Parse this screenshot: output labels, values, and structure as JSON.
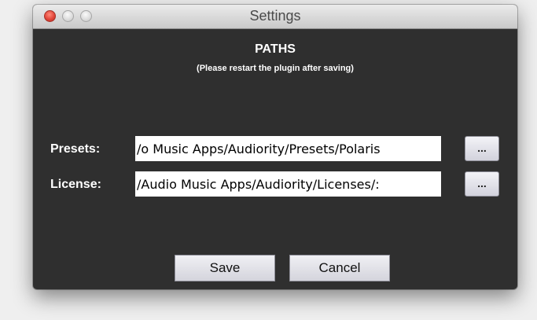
{
  "window": {
    "title": "Settings"
  },
  "header": {
    "heading": "PATHS",
    "subheading": "(Please restart the plugin after saving)"
  },
  "presets": {
    "label": "Presets:",
    "value": "o Music Apps/Audiority/Presets/Polaris/",
    "browse_label": "..."
  },
  "license": {
    "label": "License:",
    "value": ":/Audio Music Apps/Audiority/Licenses/",
    "browse_label": "..."
  },
  "actions": {
    "save_label": "Save",
    "cancel_label": "Cancel"
  },
  "colors": {
    "window_background": "#2f2f2f",
    "close_button": "#e2463a",
    "text": "#ffffff"
  }
}
